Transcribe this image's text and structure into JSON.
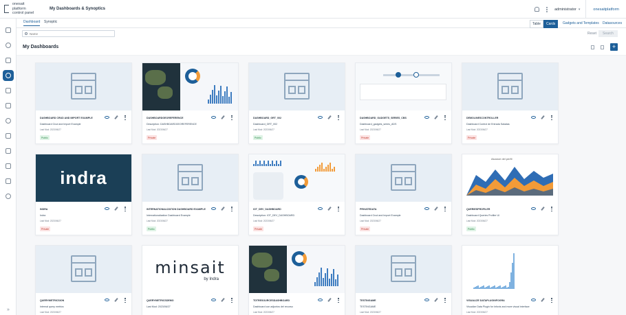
{
  "app": {
    "logo_line1": "onesait platform",
    "logo_line2": "control panel",
    "page_title": "My Dashboards & Synoptics",
    "user_name": "administrator",
    "brand_link": "onesaitplatform"
  },
  "tabs": {
    "dashboard": "Dashboard",
    "synoptic": "Synoptic"
  },
  "view_toggle": {
    "table": "Table",
    "cards": "Cards"
  },
  "links": {
    "gadgets": "Gadgets and Templates",
    "datasources": "Datasources"
  },
  "search": {
    "placeholder": "Name",
    "reset": "Reset",
    "search": "Search"
  },
  "section": {
    "title": "My Dashboards",
    "add": "+"
  },
  "cards": [
    {
      "title": "DASHBOARD CRUD AND IMPORT EXAMPLE",
      "desc": "Dashboard Crud and Import Example",
      "date": "Last Mod: 2023/06/27",
      "badge": "Public",
      "thumb": "placeholder"
    },
    {
      "title": "DASHBOARDGEOREFERENCE",
      "desc": "Description: DASHBOARDGEOREFERENCE",
      "date": "Last Mod: 2023/06/27",
      "badge": "Private",
      "thumb": "map"
    },
    {
      "title": "DASHBOARD_GRT_002",
      "desc": "Dashboard_GRT_002",
      "date": "Last Mod: 2023/06/27",
      "badge": "Public",
      "thumb": "placeholder"
    },
    {
      "title": "DASHBOARD_GADGETS_SERIES_CBS",
      "desc": "Dashboard_gadgets_series_ADS",
      "date": "Last Mod: 2023/06/27",
      "badge": "Private",
      "thumb": "timeline"
    },
    {
      "title": "DEMOLINESCONTROLLER",
      "desc": "Dashboard Control de Entrada Saladas",
      "date": "Last Mod: 2023/06/27",
      "badge": "Private",
      "thumb": "placeholder"
    },
    {
      "title": "INDRA",
      "desc": "Indra",
      "date": "Last Mod: 2023/06/27",
      "badge": "Private",
      "thumb": "indra"
    },
    {
      "title": "INTERNATIONALIZATION DASHBOARD EXAMPLE",
      "desc": "Internationalization Dashboard Example",
      "date": "Last Mod: 2023/06/27",
      "badge": "Public",
      "thumb": "placeholder"
    },
    {
      "title": "IOT_DEV_DASHBOARD",
      "desc": "Description: IOT_DEV_DASHBOARD",
      "date": "Last Mod: 2023/06/27",
      "badge": "Private",
      "thumb": "dash"
    },
    {
      "title": "PRIVATEDATA",
      "desc": "Dashboard Crud and Import Example",
      "date": "Last Mod: 2023/06/27",
      "badge": "Private",
      "thumb": "placeholder"
    },
    {
      "title": "QUERIESPROFILER",
      "desc": "Dashboard Queries Profiler UI",
      "date": "Last Mod: 2023/06/27",
      "badge": "Public",
      "thumb": "area"
    },
    {
      "title": "QUERYMETRICSION",
      "desc": "Internal query metrics",
      "date": "Last Mod: 2023/06/27",
      "badge": "",
      "thumb": "placeholder"
    },
    {
      "title": "QUERYMETRICSDEMO",
      "desc": "Last Mod: 2023/06/27",
      "date": "",
      "badge": "",
      "thumb": "minsait"
    },
    {
      "title": "TDTRESOURCESDASHBOARD",
      "desc": "Dashboard con adjuntos del recurso",
      "date": "Last Mod: 2023/06/27",
      "badge": "",
      "thumb": "map"
    },
    {
      "title": "TESTINGAME",
      "desc": "TESTINGAME",
      "date": "Last Mod: 2023/06/27",
      "badge": "",
      "thumb": "placeholder"
    },
    {
      "title": "VISUALIZE DATAPLUGINFOGRA",
      "desc": "Visualize Data Plugin for Infovis and more visual interface",
      "date": "Last Mod: 2023/06/27",
      "badge": "",
      "thumb": "bars"
    }
  ],
  "thumb_texts": {
    "indra": "indra",
    "minsait": "minsait",
    "minsait_sub": "by Indra",
    "area_title": "Alcance del perfil"
  }
}
